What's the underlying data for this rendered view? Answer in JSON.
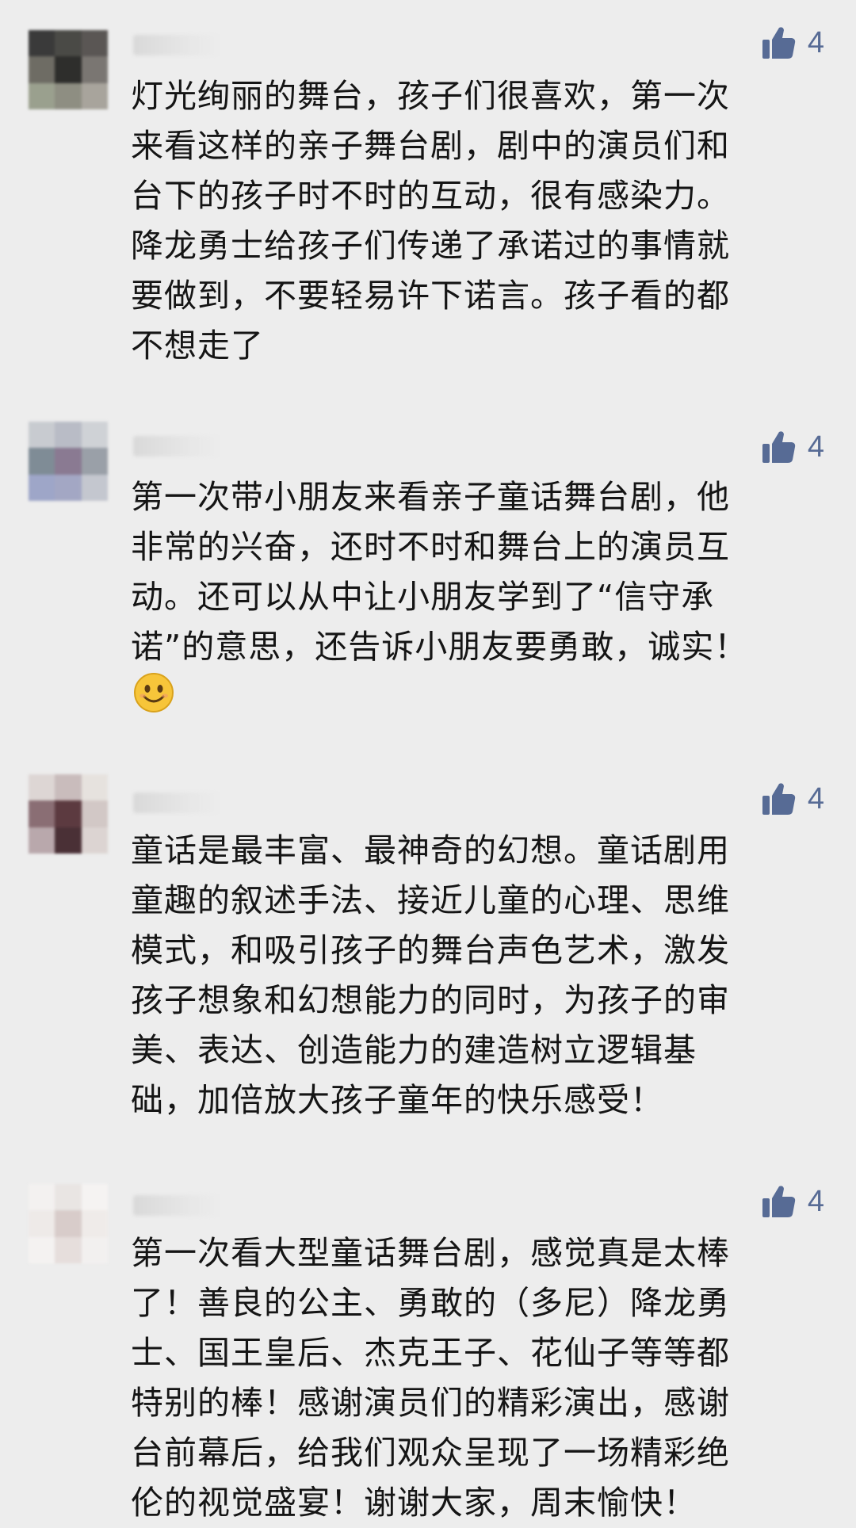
{
  "comments": [
    {
      "nickname": "",
      "likes": "4",
      "text": "灯光绚丽的舞台，孩子们很喜欢，第一次\n来看这样的亲子舞台剧，剧中的演员们和\n台下的孩子时不时的互动，很有感染力。\n降龙勇士给孩子们传递了承诺过的事情就\n要做到，不要轻易许下诺言。孩子看的都\n不想走了",
      "avatar_colors": [
        "#3a3a3a",
        "#4a4a46",
        "#5a5654",
        "#6e6c64",
        "#2e2e2c",
        "#7a7672",
        "#9aa08e",
        "#8e8e82",
        "#a8a49c"
      ]
    },
    {
      "nickname": "",
      "likes": "4",
      "text": "第一次带小朋友来看亲子童话舞台剧，他\n非常的兴奋，还时不时和舞台上的演员互\n动。还可以从中让小朋友学到了“信守承\n诺”的意思，还告诉小朋友要勇敢，诚实！",
      "emoji": "smile-emoji",
      "avatar_colors": [
        "#c8cbd0",
        "#b9bcc6",
        "#cfd2d6",
        "#7f8c96",
        "#8a7a92",
        "#9aa0a8",
        "#9ea6c8",
        "#a3a7c4",
        "#c4c7cf"
      ]
    },
    {
      "nickname": "",
      "likes": "4",
      "text": "童话是最丰富、最神奇的幻想。童话剧用\n童趣的叙述手法、接近儿童的心理、思维\n模式，和吸引孩子的舞台声色艺术，激发\n孩子想象和幻想能力的同时，为孩子的审\n美、表达、创造能力的建造树立逻辑基\n础，加倍放大孩子童年的快乐感受！",
      "avatar_colors": [
        "#ddd6d4",
        "#c9bcbc",
        "#e6e2de",
        "#8a6e74",
        "#5c3a40",
        "#d2c8c6",
        "#b9a8ac",
        "#4a3036",
        "#dcd4d2"
      ]
    },
    {
      "nickname": "",
      "likes": "4",
      "text": "第一次看大型童话舞台剧，感觉真是太棒\n了！善良的公主、勇敢的（多尼）降龙勇\n士、国王皇后、杰克王子、花仙子等等都\n特别的棒！感谢演员们的精彩演出，感谢\n台前幕后，给我们观众呈现了一场精彩绝\n伦的视觉盛宴！谢谢大家，周末愉快！",
      "avatar_colors": [
        "#f3f1f0",
        "#e9e5e3",
        "#f5f3f2",
        "#eeeae8",
        "#d8ccca",
        "#efebe9",
        "#f4f2f1",
        "#e6dedc",
        "#f2f0ef"
      ]
    }
  ],
  "colors": {
    "background": "#ededed",
    "like_blue": "#576b95",
    "text": "#151515"
  },
  "icons": {
    "like": "thumbs-up-icon",
    "emoji": "smile-emoji-icon"
  }
}
